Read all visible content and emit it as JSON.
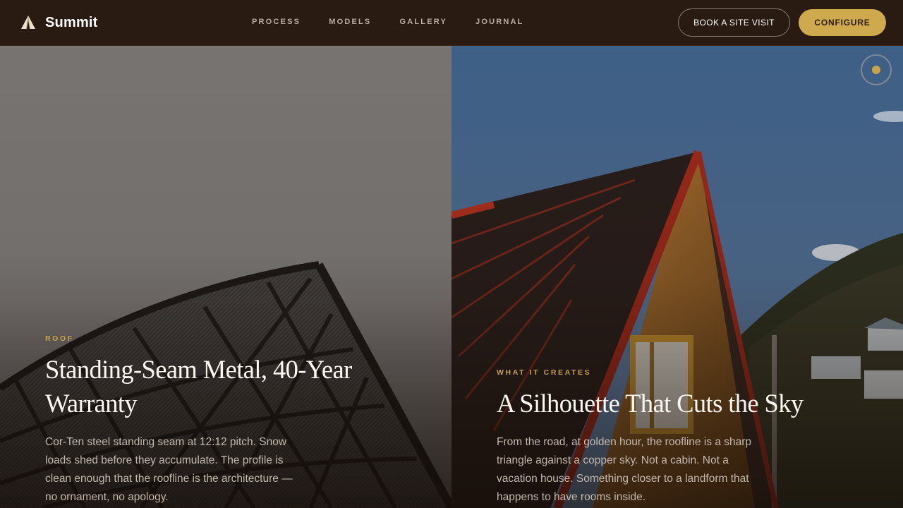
{
  "brand": {
    "name": "Summit",
    "logo": "mountain-tent-icon"
  },
  "nav": {
    "links": [
      "PROCESS",
      "MODELS",
      "GALLERY",
      "JOURNAL"
    ],
    "cta_outline": "BOOK A SITE VISIT",
    "cta_primary": "CONFIGURE"
  },
  "panels": {
    "left": {
      "eyebrow": "ROOF",
      "headline": "Standing-Seam Metal, 40-Year Warranty",
      "body": "Cor-Ten steel standing seam at 12:12 pitch. Snow loads shed before they accumulate. The profile is clean enough that the roofline is the architecture — no ornament, no apology."
    },
    "right": {
      "eyebrow": "WHAT IT CREATES",
      "headline": "A Silhouette That Cuts the Sky",
      "body": "From the road, at golden hour, the roofline is a sharp triangle against a copper sky. Not a cabin. Not a vacation house. Something closer to a landform that happens to have rooms inside."
    }
  },
  "colors": {
    "nav_bg": "#2a1b12",
    "accent_gold": "#cfa94d",
    "eyebrow_gold": "#c9a24c",
    "headline": "#fbf7f1",
    "body_text": "#c3b8ae"
  }
}
